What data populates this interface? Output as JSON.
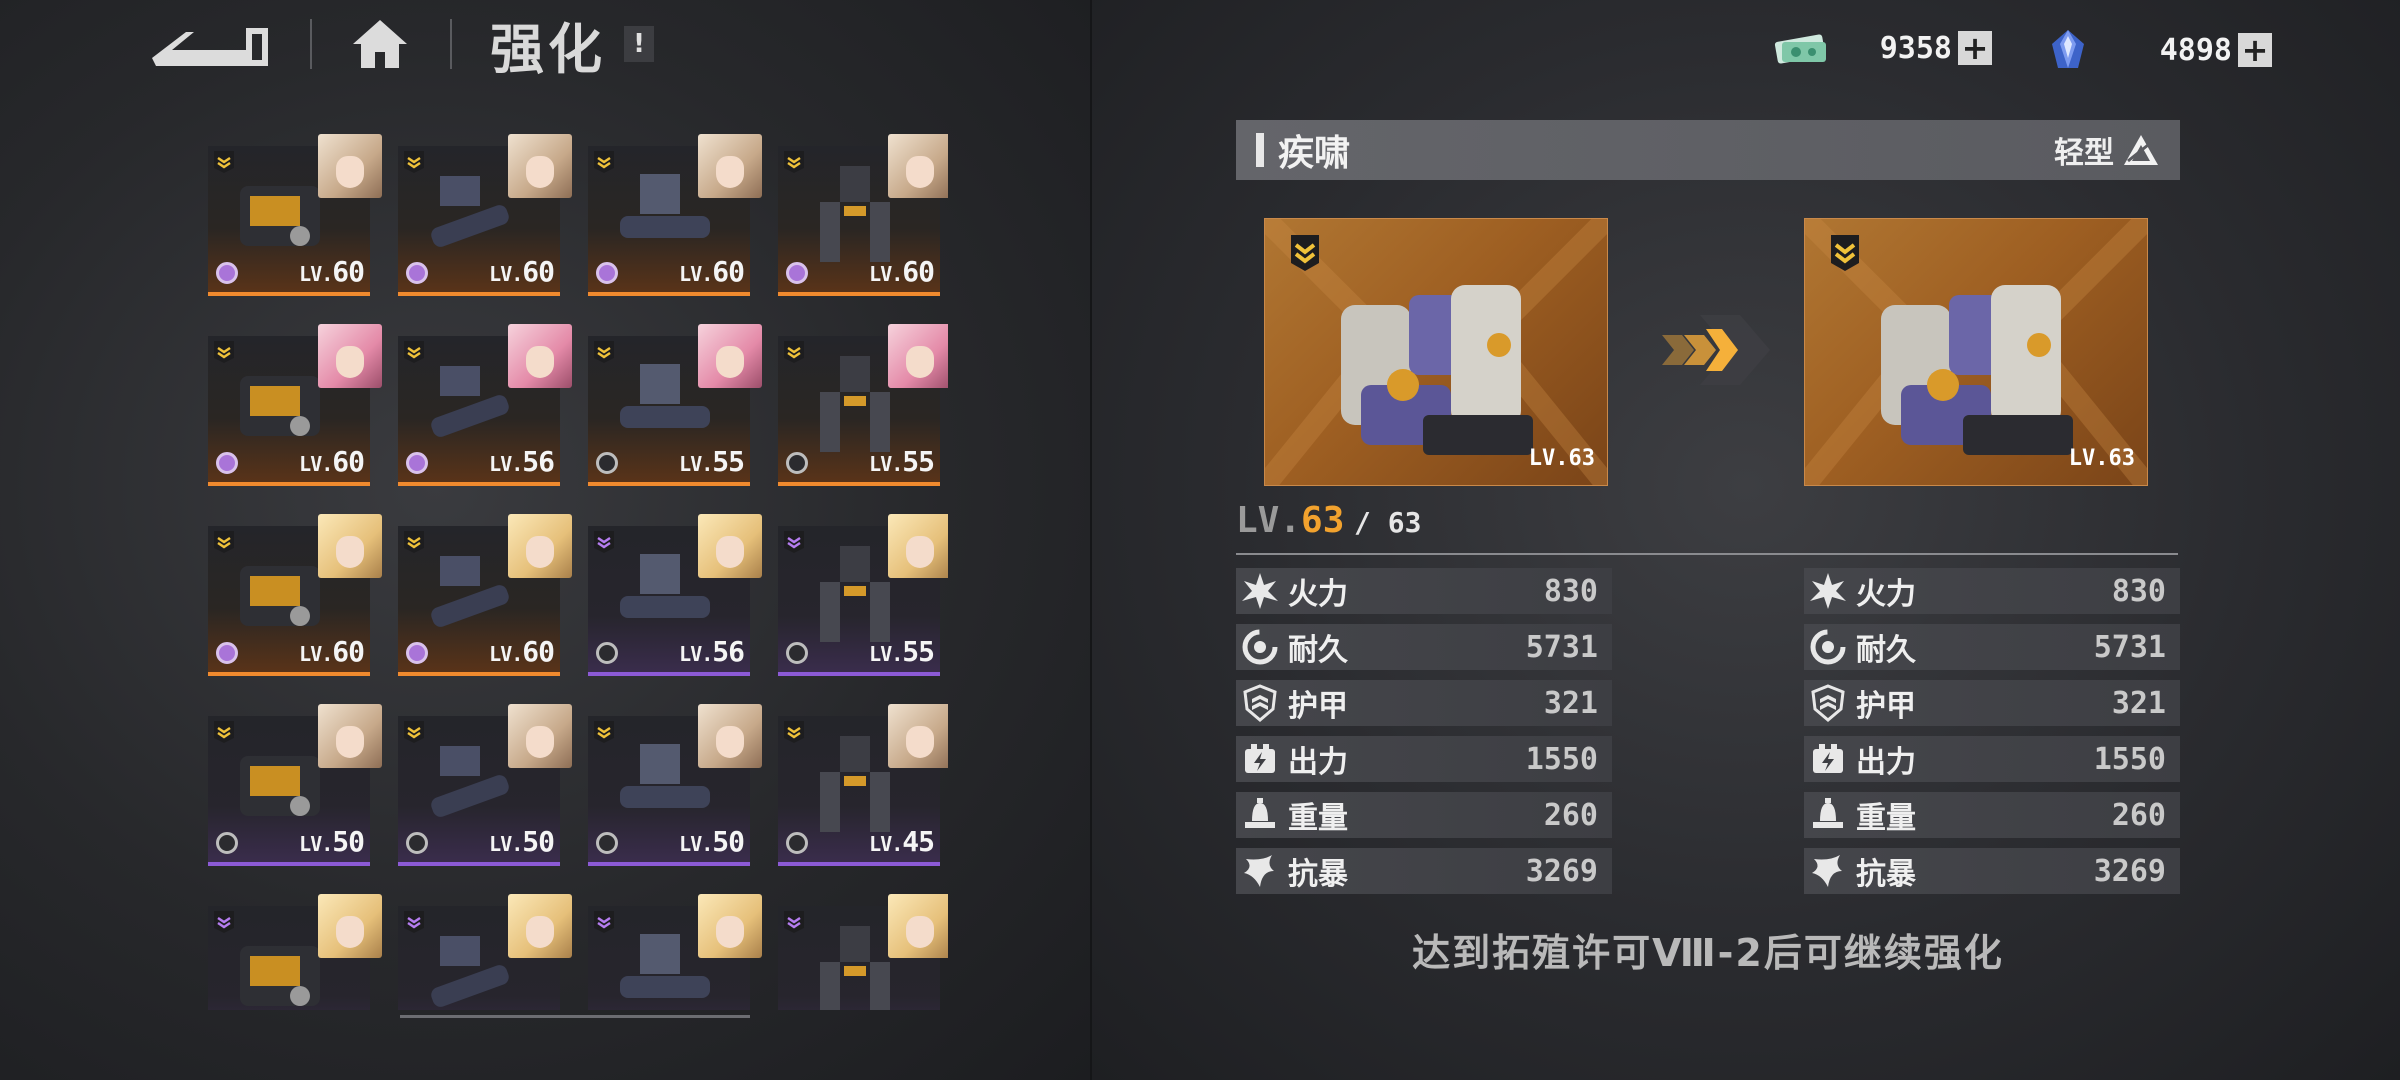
{
  "header": {
    "title": "强化",
    "info_badge": "!"
  },
  "currency": [
    {
      "icon": "cash-ticket-icon",
      "value": "9358"
    },
    {
      "icon": "blue-crystal-icon",
      "value": "4898"
    }
  ],
  "plus_label": "+",
  "grid": {
    "cards": [
      {
        "level_prefix": "LV.",
        "level": "60",
        "rarity": "orange",
        "rank": "gold",
        "slot": "filled",
        "portrait": "silver"
      },
      {
        "level_prefix": "LV.",
        "level": "60",
        "rarity": "orange",
        "rank": "gold",
        "slot": "filled",
        "portrait": "silver"
      },
      {
        "level_prefix": "LV.",
        "level": "60",
        "rarity": "orange",
        "rank": "gold",
        "slot": "filled",
        "portrait": "silver"
      },
      {
        "level_prefix": "LV.",
        "level": "60",
        "rarity": "orange",
        "rank": "gold",
        "slot": "filled",
        "portrait": "silver"
      },
      {
        "level_prefix": "LV.",
        "level": "60",
        "rarity": "orange",
        "rank": "gold",
        "slot": "filled",
        "portrait": "pink"
      },
      {
        "level_prefix": "LV.",
        "level": "56",
        "rarity": "orange",
        "rank": "gold",
        "slot": "filled",
        "portrait": "pink"
      },
      {
        "level_prefix": "LV.",
        "level": "55",
        "rarity": "orange",
        "rank": "gold",
        "slot": "empty",
        "portrait": "pink"
      },
      {
        "level_prefix": "LV.",
        "level": "55",
        "rarity": "orange",
        "rank": "gold",
        "slot": "empty",
        "portrait": "pink"
      },
      {
        "level_prefix": "LV.",
        "level": "60",
        "rarity": "orange",
        "rank": "gold",
        "slot": "filled",
        "portrait": "blond"
      },
      {
        "level_prefix": "LV.",
        "level": "60",
        "rarity": "orange",
        "rank": "gold",
        "slot": "filled",
        "portrait": "blond"
      },
      {
        "level_prefix": "LV.",
        "level": "56",
        "rarity": "purple",
        "rank": "purple",
        "slot": "empty",
        "portrait": "blond"
      },
      {
        "level_prefix": "LV.",
        "level": "55",
        "rarity": "purple",
        "rank": "purple",
        "slot": "empty",
        "portrait": "blond"
      },
      {
        "level_prefix": "LV.",
        "level": "50",
        "rarity": "purple",
        "rank": "gold",
        "slot": "empty",
        "portrait": "silver"
      },
      {
        "level_prefix": "LV.",
        "level": "50",
        "rarity": "purple",
        "rank": "gold",
        "slot": "empty",
        "portrait": "silver"
      },
      {
        "level_prefix": "LV.",
        "level": "50",
        "rarity": "purple",
        "rank": "gold",
        "slot": "empty",
        "portrait": "silver"
      },
      {
        "level_prefix": "LV.",
        "level": "45",
        "rarity": "purple",
        "rank": "gold",
        "slot": "empty",
        "portrait": "silver"
      },
      {
        "level_prefix": "",
        "level": "",
        "rarity": "purple",
        "rank": "purple",
        "slot": "none",
        "portrait": "blond"
      },
      {
        "level_prefix": "",
        "level": "",
        "rarity": "purple",
        "rank": "purple",
        "slot": "none",
        "portrait": "blond"
      },
      {
        "level_prefix": "",
        "level": "",
        "rarity": "purple",
        "rank": "purple",
        "slot": "none",
        "portrait": "blond"
      },
      {
        "level_prefix": "",
        "level": "",
        "rarity": "purple",
        "rank": "purple",
        "slot": "none",
        "portrait": "blond"
      }
    ]
  },
  "detail": {
    "name": "疾啸",
    "type": "轻型",
    "preview_before": {
      "level": "LV.63"
    },
    "preview_after": {
      "level": "LV.63"
    },
    "level_prefix": "LV.",
    "level_current": "63",
    "level_max": "/ 63",
    "stats_before": [
      {
        "icon": "firepower-icon",
        "label": "火力",
        "value": "830"
      },
      {
        "icon": "durability-icon",
        "label": "耐久",
        "value": "5731"
      },
      {
        "icon": "armor-icon",
        "label": "护甲",
        "value": "321"
      },
      {
        "icon": "power-output-icon",
        "label": "出力",
        "value": "1550"
      },
      {
        "icon": "weight-icon",
        "label": "重量",
        "value": "260"
      },
      {
        "icon": "anti-riot-icon",
        "label": "抗暴",
        "value": "3269"
      }
    ],
    "stats_after": [
      {
        "icon": "firepower-icon",
        "label": "火力",
        "value": "830"
      },
      {
        "icon": "durability-icon",
        "label": "耐久",
        "value": "5731"
      },
      {
        "icon": "armor-icon",
        "label": "护甲",
        "value": "321"
      },
      {
        "icon": "power-output-icon",
        "label": "出力",
        "value": "1550"
      },
      {
        "icon": "weight-icon",
        "label": "重量",
        "value": "260"
      },
      {
        "icon": "anti-riot-icon",
        "label": "抗暴",
        "value": "3269"
      }
    ],
    "notice": "达到拓殖许可Ⅷ-2后可继续强化"
  },
  "colors": {
    "accent_orange": "#f2a22e",
    "rarity_orange": "#f08a2e",
    "rarity_purple": "#8c5ad6"
  }
}
